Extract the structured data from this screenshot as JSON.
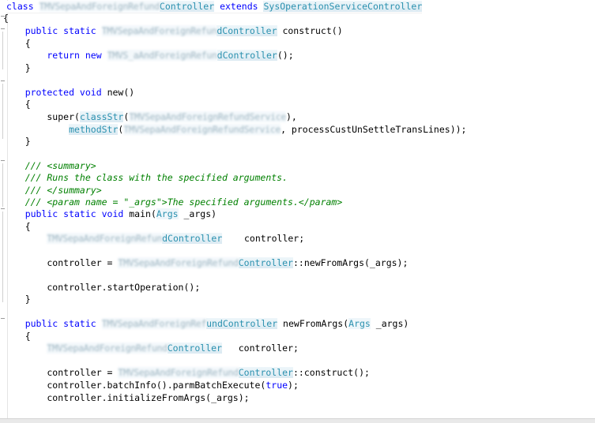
{
  "colors": {
    "keyword": "#0000ff",
    "type": "#2b91af",
    "comment": "#008000",
    "plain": "#000000",
    "background": "#ffffff"
  },
  "code": {
    "lines": [
      [
        {
          "k": "kw",
          "t": "class "
        },
        {
          "k": "blur",
          "t": "TMVSepaAndForeignRefund"
        },
        {
          "k": "ph",
          "t": "Controller"
        },
        {
          "k": "pl",
          "t": " "
        },
        {
          "k": "kw",
          "t": "extends "
        },
        {
          "k": "ph",
          "t": "SysOperationServiceController"
        }
      ],
      [
        {
          "k": "pl",
          "t": "{"
        }
      ],
      [
        {
          "k": "kw",
          "t": "    public static "
        },
        {
          "k": "blur",
          "t": "TMVSepaAndForeignRefun"
        },
        {
          "k": "ph",
          "t": "dController"
        },
        {
          "k": "pl",
          "t": " construct()"
        }
      ],
      [
        {
          "k": "pl",
          "t": "    {"
        }
      ],
      [
        {
          "k": "kw",
          "t": "        return new "
        },
        {
          "k": "blur",
          "t": "TMVS_aAndForeignRefun"
        },
        {
          "k": "ph",
          "t": "dController"
        },
        {
          "k": "pl",
          "t": "();"
        }
      ],
      [
        {
          "k": "pl",
          "t": "    }"
        }
      ],
      [
        {
          "k": "pl",
          "t": ""
        }
      ],
      [
        {
          "k": "kw",
          "t": "    protected void "
        },
        {
          "k": "pl",
          "t": "new()"
        }
      ],
      [
        {
          "k": "pl",
          "t": "    {"
        }
      ],
      [
        {
          "k": "pl",
          "t": "        super("
        },
        {
          "k": "ph",
          "t": "classStr"
        },
        {
          "k": "pl",
          "t": "("
        },
        {
          "k": "blur",
          "t": "TMVSepaAndForeignRefundService"
        },
        {
          "k": "pl",
          "t": "),"
        }
      ],
      [
        {
          "k": "pl",
          "t": "            "
        },
        {
          "k": "ph",
          "t": "methodStr"
        },
        {
          "k": "pl",
          "t": "("
        },
        {
          "k": "blur",
          "t": "TMVSepaAndForeignRefundService"
        },
        {
          "k": "pl",
          "t": ", processCustUnSettleTransLines));"
        }
      ],
      [
        {
          "k": "pl",
          "t": "    }"
        }
      ],
      [
        {
          "k": "pl",
          "t": ""
        }
      ],
      [
        {
          "k": "cm",
          "t": "    /// <summary>"
        }
      ],
      [
        {
          "k": "cm",
          "t": "    /// Runs the class with the specified arguments."
        }
      ],
      [
        {
          "k": "cm",
          "t": "    /// </summary>"
        }
      ],
      [
        {
          "k": "cm",
          "t": "    /// <param name = \"_args\">The specified arguments.</param>"
        }
      ],
      [
        {
          "k": "kw",
          "t": "    public static void "
        },
        {
          "k": "pl",
          "t": "main("
        },
        {
          "k": "ty",
          "t": "Args"
        },
        {
          "k": "pl",
          "t": " _args)"
        }
      ],
      [
        {
          "k": "pl",
          "t": "    {"
        }
      ],
      [
        {
          "k": "pl",
          "t": "        "
        },
        {
          "k": "blur",
          "t": "TMVSepaAndForeignRefun"
        },
        {
          "k": "ph",
          "t": "dController"
        },
        {
          "k": "pl",
          "t": "    controller;"
        }
      ],
      [
        {
          "k": "pl",
          "t": ""
        }
      ],
      [
        {
          "k": "pl",
          "t": "        controller = "
        },
        {
          "k": "blur",
          "t": "TMVSepaAndForeignRefund"
        },
        {
          "k": "ph",
          "t": "Controller"
        },
        {
          "k": "pl",
          "t": "::newFromArgs(_args);"
        }
      ],
      [
        {
          "k": "pl",
          "t": ""
        }
      ],
      [
        {
          "k": "pl",
          "t": "        controller.startOperation();"
        }
      ],
      [
        {
          "k": "pl",
          "t": "    }"
        }
      ],
      [
        {
          "k": "pl",
          "t": ""
        }
      ],
      [
        {
          "k": "kw",
          "t": "    public static "
        },
        {
          "k": "blur",
          "t": "TMVSepaAndForeignRef"
        },
        {
          "k": "ph",
          "t": "undController"
        },
        {
          "k": "pl",
          "t": " newFromArgs("
        },
        {
          "k": "ty",
          "t": "Args"
        },
        {
          "k": "pl",
          "t": " _args)"
        }
      ],
      [
        {
          "k": "pl",
          "t": "    {"
        }
      ],
      [
        {
          "k": "pl",
          "t": "        "
        },
        {
          "k": "blur",
          "t": "TMVSepaAndForeignRefund"
        },
        {
          "k": "ph",
          "t": "Controller"
        },
        {
          "k": "pl",
          "t": "   controller;"
        }
      ],
      [
        {
          "k": "pl",
          "t": ""
        }
      ],
      [
        {
          "k": "pl",
          "t": "        controller = "
        },
        {
          "k": "blur",
          "t": "TMVSepaAndForeignRefund"
        },
        {
          "k": "ph",
          "t": "Controller"
        },
        {
          "k": "pl",
          "t": "::construct();"
        }
      ],
      [
        {
          "k": "pl",
          "t": "        controller.batchInfo().parmBatchExecute("
        },
        {
          "k": "kw",
          "t": "true"
        },
        {
          "k": "pl",
          "t": ");"
        }
      ],
      [
        {
          "k": "pl",
          "t": "        controller.initializeFromArgs(_args);"
        }
      ]
    ]
  }
}
